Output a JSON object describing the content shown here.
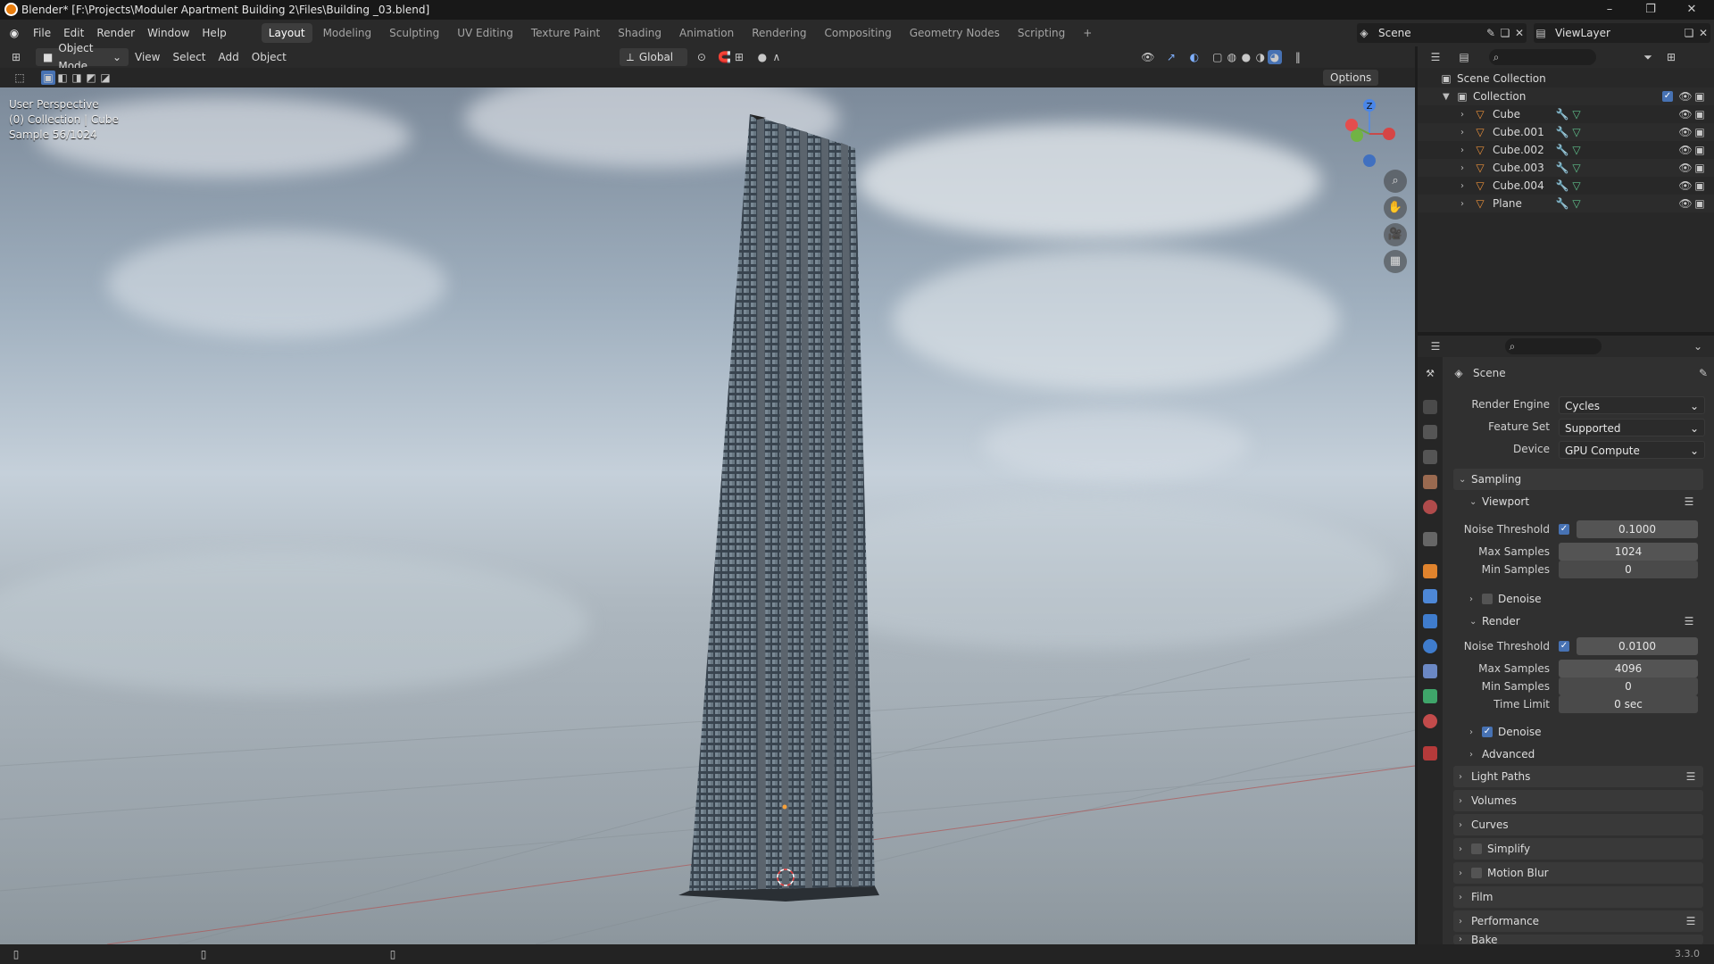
{
  "window": {
    "title": "Blender* [F:\\Projects\\Moduler Apartment Building 2\\Files\\Building _03.blend]"
  },
  "menu": [
    "File",
    "Edit",
    "Render",
    "Window",
    "Help"
  ],
  "workspaces": [
    "Layout",
    "Modeling",
    "Sculpting",
    "UV Editing",
    "Texture Paint",
    "Shading",
    "Animation",
    "Rendering",
    "Compositing",
    "Geometry Nodes",
    "Scripting",
    "+"
  ],
  "active_workspace": "Layout",
  "scene_field": "Scene",
  "viewlayer_field": "ViewLayer",
  "viewport_header": {
    "mode": "Object Mode",
    "menus": [
      "View",
      "Select",
      "Add",
      "Object"
    ],
    "transform": "Global",
    "options": "Options"
  },
  "viewport_overlay": {
    "line1": "User Perspective",
    "line2": "(0) Collection | Cube",
    "line3": "Sample 56/1024"
  },
  "gizmo": {
    "z_label": "Z"
  },
  "outliner": {
    "root": "Scene Collection",
    "collection": "Collection",
    "items": [
      "Cube",
      "Cube.001",
      "Cube.002",
      "Cube.003",
      "Cube.004",
      "Plane"
    ]
  },
  "properties": {
    "context": "Scene",
    "render_engine_label": "Render Engine",
    "render_engine": "Cycles",
    "feature_set_label": "Feature Set",
    "feature_set": "Supported",
    "device_label": "Device",
    "device": "GPU Compute",
    "sampling": "Sampling",
    "viewport": "Viewport",
    "vp_noise_label": "Noise Threshold",
    "vp_noise": "0.1000",
    "vp_max_label": "Max Samples",
    "vp_max": "1024",
    "vp_min_label": "Min Samples",
    "vp_min": "0",
    "vp_denoise": "Denoise",
    "render": "Render",
    "r_noise_label": "Noise Threshold",
    "r_noise": "0.0100",
    "r_max_label": "Max Samples",
    "r_max": "4096",
    "r_min_label": "Min Samples",
    "r_min": "0",
    "r_time_label": "Time Limit",
    "r_time": "0 sec",
    "r_denoise": "Denoise",
    "advanced": "Advanced",
    "panels": [
      "Light Paths",
      "Volumes",
      "Curves",
      "Simplify",
      "Motion Blur",
      "Film",
      "Performance",
      "Bake"
    ]
  },
  "version": "3.3.0",
  "colors": {
    "accent": "#4772b3",
    "viewport_sky_top": "#7c8a9a",
    "panel": "#303030"
  }
}
